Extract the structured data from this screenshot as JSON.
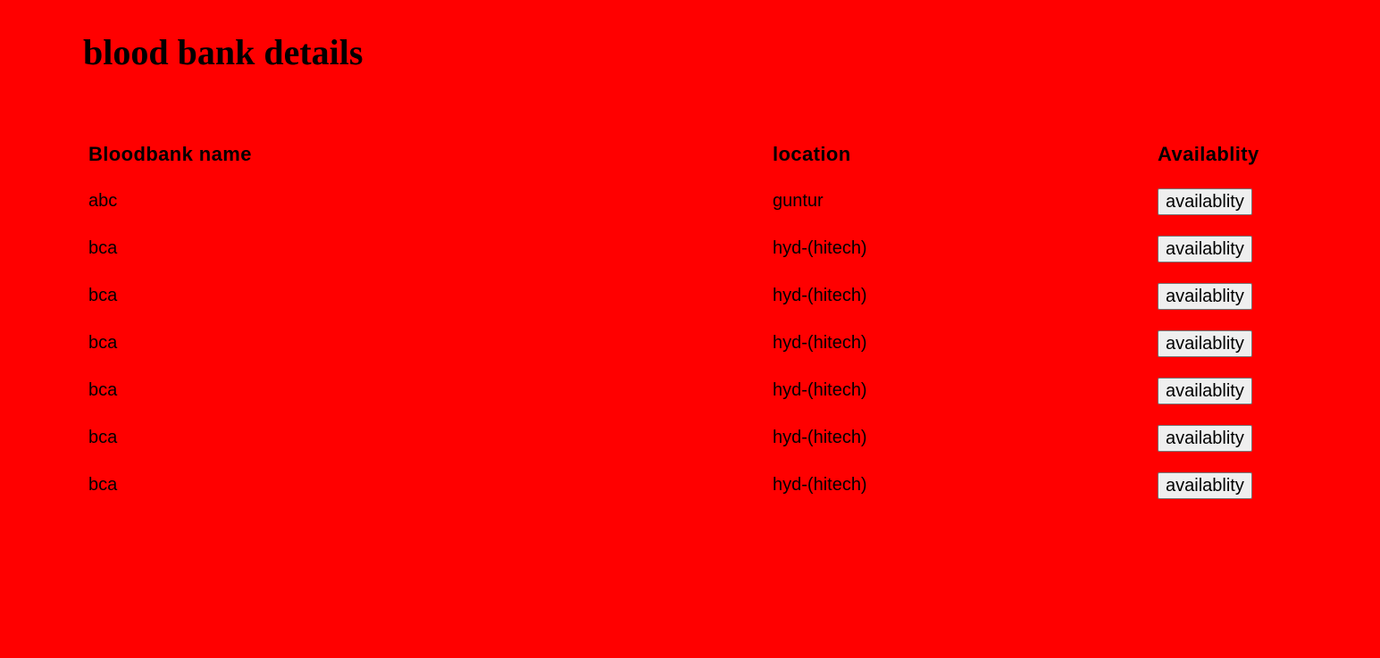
{
  "colors": {
    "background": "#ff0000",
    "text": "#000000",
    "button_background": "#efefef"
  },
  "page": {
    "title": "blood bank details"
  },
  "table": {
    "headers": {
      "name": "Bloodbank name",
      "location": "location",
      "availability": "Availablity"
    },
    "rows": [
      {
        "name": "abc",
        "location": "guntur",
        "button_label": "availablity"
      },
      {
        "name": "bca",
        "location": "hyd-(hitech)",
        "button_label": "availablity"
      },
      {
        "name": "bca",
        "location": "hyd-(hitech)",
        "button_label": "availablity"
      },
      {
        "name": "bca",
        "location": "hyd-(hitech)",
        "button_label": "availablity"
      },
      {
        "name": "bca",
        "location": "hyd-(hitech)",
        "button_label": "availablity"
      },
      {
        "name": "bca",
        "location": "hyd-(hitech)",
        "button_label": "availablity"
      },
      {
        "name": "bca",
        "location": "hyd-(hitech)",
        "button_label": "availablity"
      }
    ]
  }
}
